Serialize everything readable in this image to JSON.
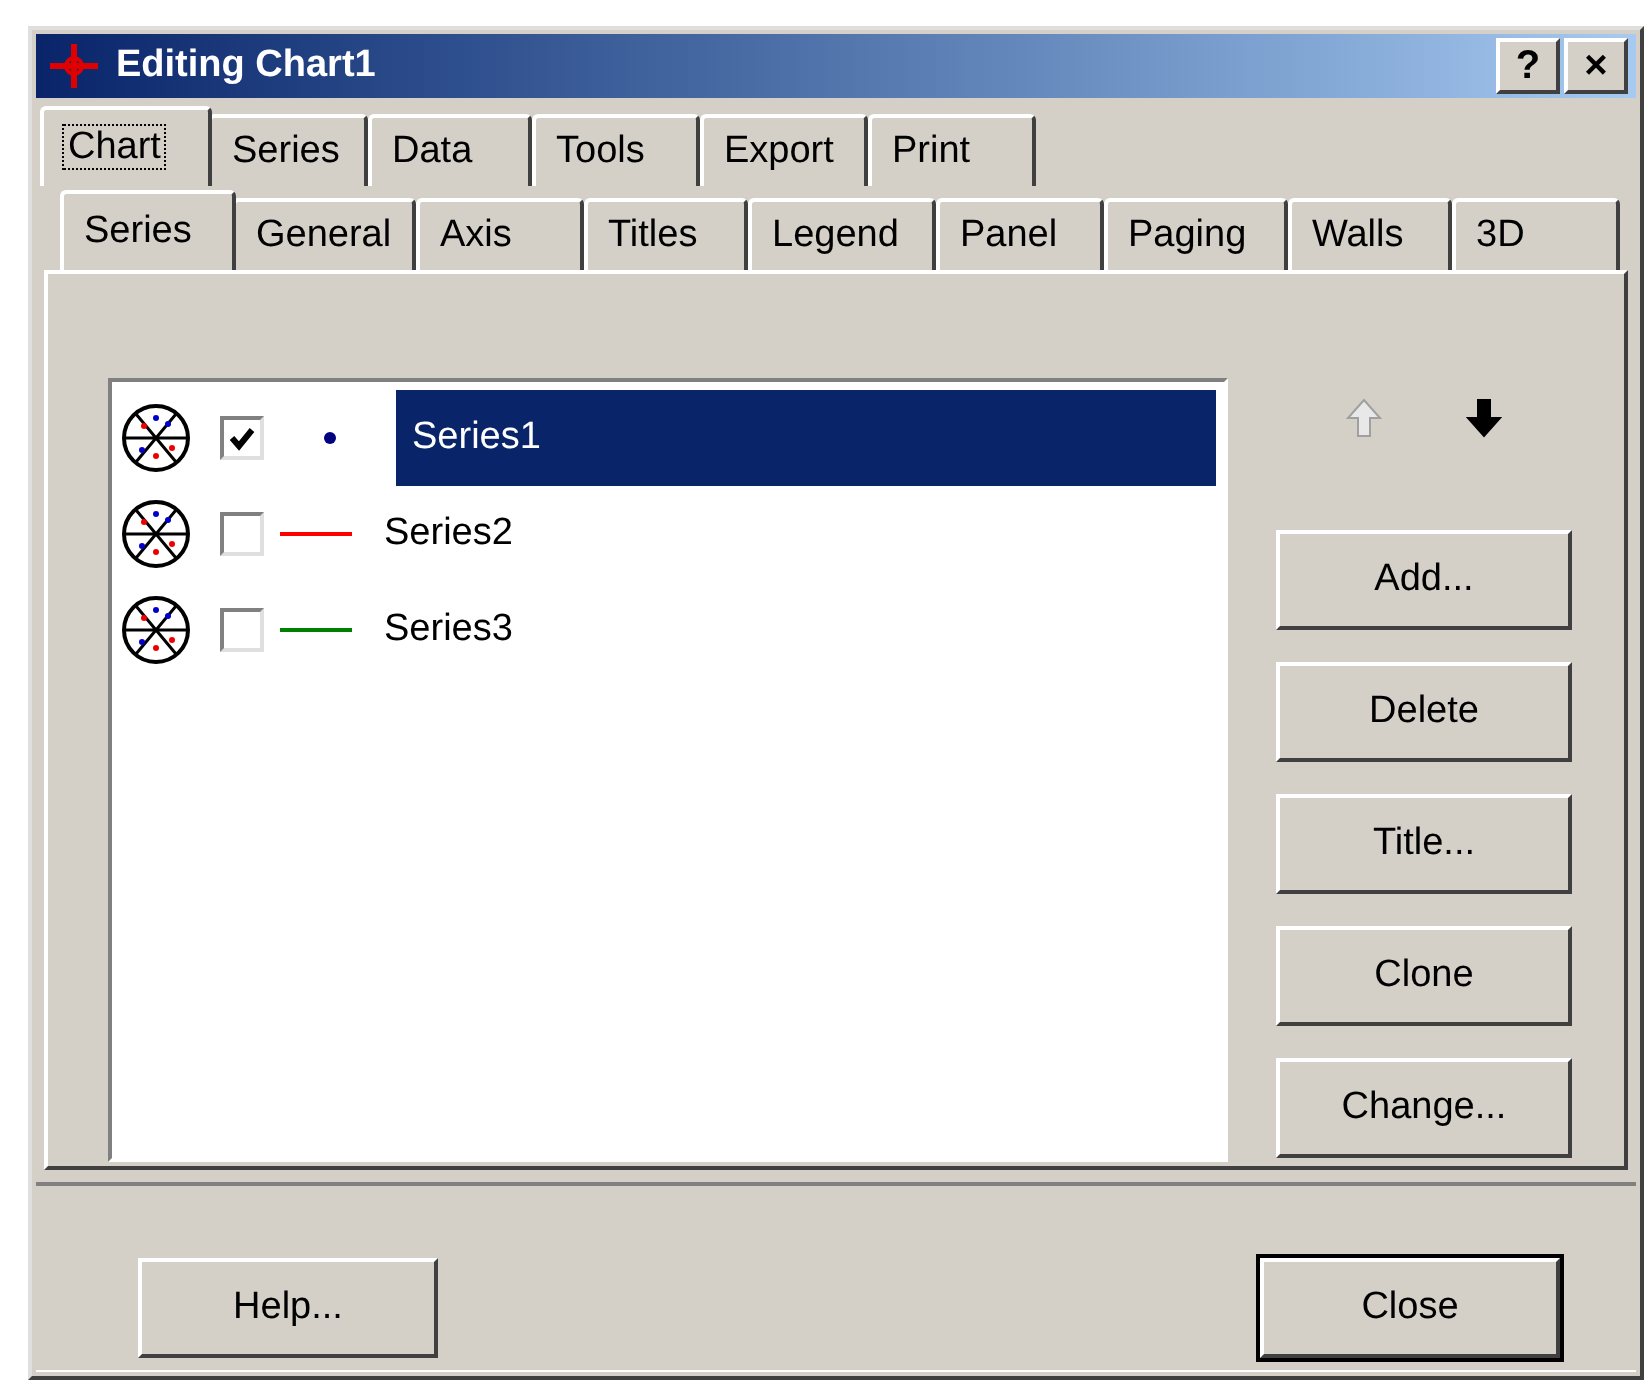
{
  "window": {
    "title": "Editing Chart1",
    "title_buttons": [
      "?",
      "×"
    ]
  },
  "tabs": [
    {
      "label": "Chart",
      "selected": true
    },
    {
      "label": "Series",
      "selected": false
    },
    {
      "label": "Data",
      "selected": false
    },
    {
      "label": "Tools",
      "selected": false
    },
    {
      "label": "Export",
      "selected": false
    },
    {
      "label": "Print",
      "selected": false
    }
  ],
  "subtabs": [
    {
      "label": "Series",
      "selected": true
    },
    {
      "label": "General",
      "selected": false
    },
    {
      "label": "Axis",
      "selected": false
    },
    {
      "label": "Titles",
      "selected": false
    },
    {
      "label": "Legend",
      "selected": false
    },
    {
      "label": "Panel",
      "selected": false
    },
    {
      "label": "Paging",
      "selected": false
    },
    {
      "label": "Walls",
      "selected": false
    },
    {
      "label": "3D",
      "selected": false
    }
  ],
  "series": [
    {
      "name": "Series1",
      "checked": true,
      "selected": true,
      "kind": "dot",
      "color": "#000080"
    },
    {
      "name": "Series2",
      "checked": false,
      "selected": false,
      "kind": "line",
      "color": "#ff0000"
    },
    {
      "name": "Series3",
      "checked": false,
      "selected": false,
      "kind": "line",
      "color": "#008000"
    }
  ],
  "move_buttons": [
    {
      "kind": "up",
      "disabled": true
    },
    {
      "kind": "down",
      "disabled": false
    }
  ],
  "buttons": [
    "Add...",
    "Delete",
    "Title...",
    "Clone",
    "Change..."
  ],
  "footer_buttons": [
    {
      "label": "Help...",
      "default": false
    },
    {
      "label": "Close",
      "default": true
    }
  ]
}
